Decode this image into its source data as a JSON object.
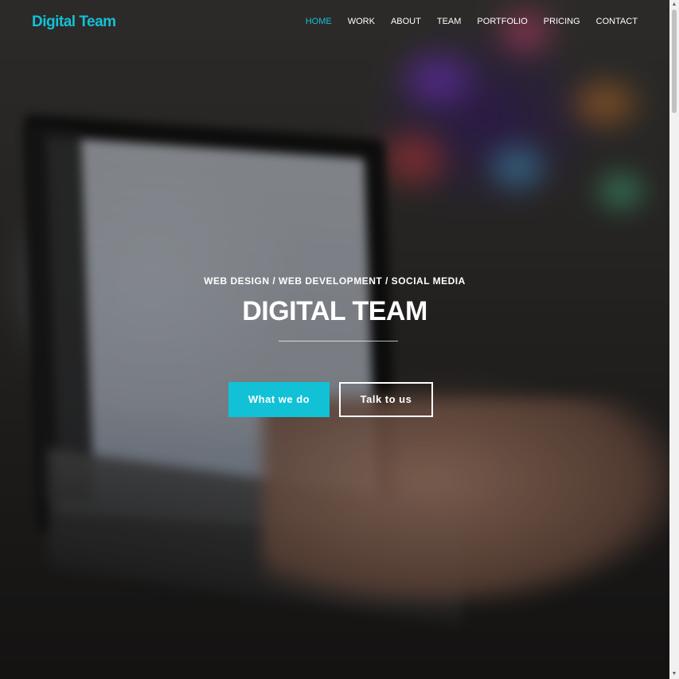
{
  "brand": {
    "name": "Digital Team"
  },
  "nav": {
    "items": [
      {
        "label": "HOME",
        "active": true
      },
      {
        "label": "WORK",
        "active": false
      },
      {
        "label": "ABOUT",
        "active": false
      },
      {
        "label": "TEAM",
        "active": false
      },
      {
        "label": "PORTFOLIO",
        "active": false
      },
      {
        "label": "PRICING",
        "active": false
      },
      {
        "label": "CONTACT",
        "active": false
      }
    ]
  },
  "hero": {
    "subtitle": "WEB DESIGN / WEB DEVELOPMENT / SOCIAL MEDIA",
    "title": "DIGITAL TEAM",
    "primary_button": "What we do",
    "secondary_button": "Talk to us"
  },
  "colors": {
    "accent": "#12c1d6",
    "text": "#ffffff"
  }
}
